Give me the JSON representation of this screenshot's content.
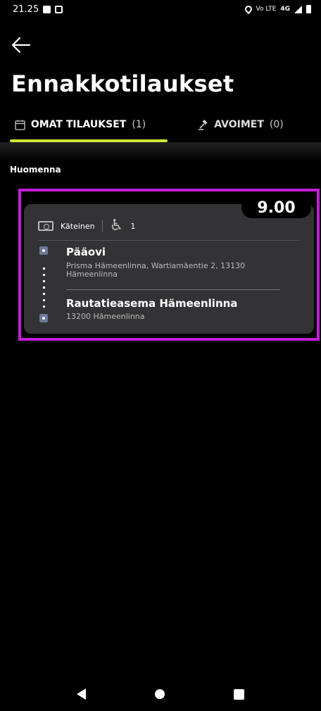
{
  "status_bar": {
    "time": "21.25",
    "network_top": "Vo LTE",
    "network_type": "4G"
  },
  "header": {
    "title": "Ennakkotilaukset"
  },
  "tabs": [
    {
      "label": "OMAT TILAUKSET",
      "count": "(1)",
      "icon": "calendar-icon",
      "active": true
    },
    {
      "label": "AVOIMET",
      "count": "(0)",
      "icon": "gavel-icon",
      "active": false
    }
  ],
  "section": {
    "date_label": "Huomenna"
  },
  "order": {
    "time": "9.00",
    "payment": "Käteinen",
    "wheelchair_count": "1",
    "pickup": {
      "name": "Pääovi",
      "address": "Prisma Hämeenlinna, Wartiamäentie 2, 13130 Hämeenlinna"
    },
    "dropoff": {
      "name": "Rautatieasema Hämeenlinna",
      "address": "13200 Hämeenlinna"
    }
  },
  "colors": {
    "accent": "#cde536",
    "highlight_frame": "#c21ed6",
    "card": "#333335"
  }
}
